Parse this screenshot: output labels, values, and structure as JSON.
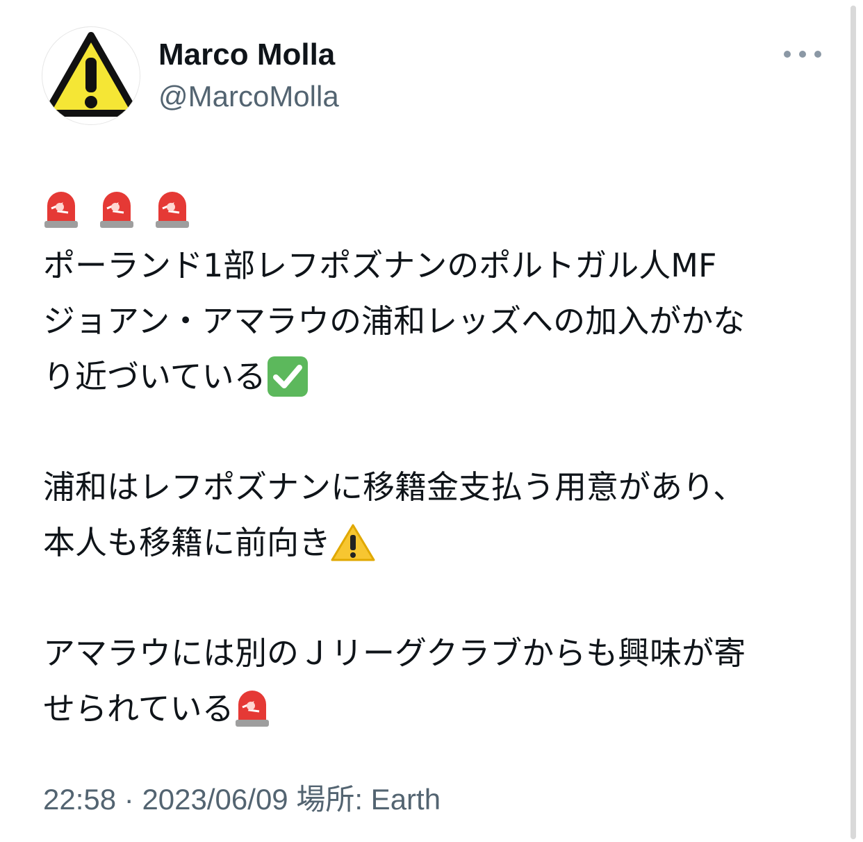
{
  "author": {
    "display_name": "Marco Molla",
    "handle": "@MarcoMolla",
    "avatar_icon": "warning-sign-icon"
  },
  "menu": {
    "more_icon": "more-dots-icon"
  },
  "tweet": {
    "lines": [
      "ポーランド1部レフポズナンのポルトガル人MF",
      "ジョアン・アマラウの浦和レッズへの加入がかな",
      "り近づいている",
      "浦和はレフポズナンに移籍金支払う用意があり、",
      "本人も移籍に前向き",
      "アマラウには別のＪリーグクラブからも興味が寄",
      "せられている"
    ],
    "emojis": {
      "siren": "police-light-icon",
      "check": "check-mark-button-icon",
      "warning": "warning-icon"
    }
  },
  "meta": {
    "time": "22:58",
    "separator": "·",
    "date": "2023/06/09",
    "location": "場所: Earth"
  },
  "colors": {
    "text": "#0f1419",
    "secondary": "#536471",
    "avatar_yellow": "#f5e635",
    "siren_red": "#e53935",
    "check_green": "#5cb85c"
  }
}
